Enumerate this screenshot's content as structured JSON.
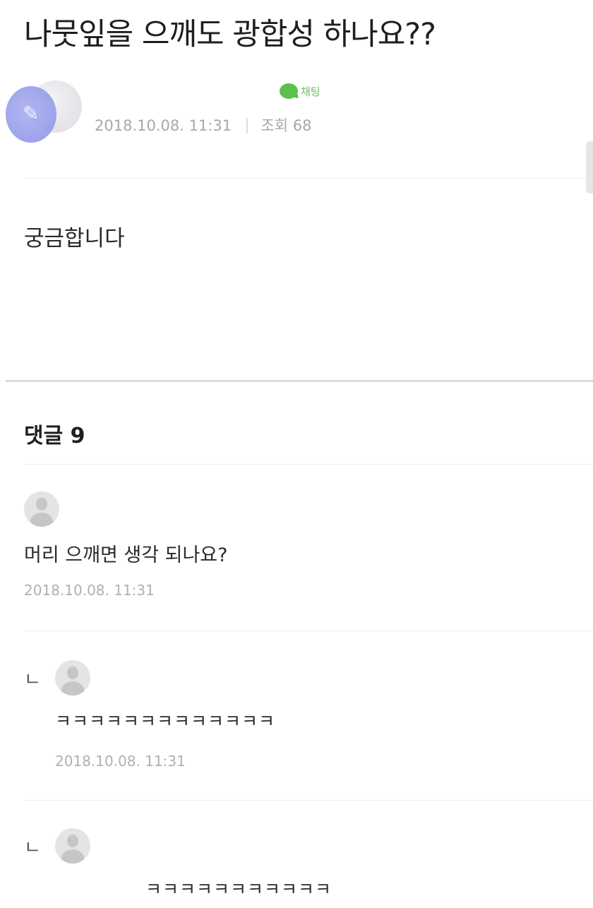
{
  "post": {
    "title": "나뭇잎을 으깨도 광합성 하나요??",
    "date": "2018.10.08. 11:31",
    "views_label": "조회 68",
    "chat_label": "채팅",
    "body": "궁금합니다"
  },
  "comments_header": "댓글 9",
  "comments": [
    {
      "text": "머리 으깨면 생각 되나요?",
      "date": "2018.10.08. 11:31"
    },
    {
      "reply_mark": "ㄴ",
      "text": "ㅋㅋㅋㅋㅋㅋㅋㅋㅋㅋㅋㅋㅋ",
      "date": "2018.10.08. 11:31"
    },
    {
      "reply_mark": "ㄴ",
      "text": "ㅋㅋㅋㅋㅋㅋㅋㅋㅋㅋㅋ"
    }
  ],
  "colors": {
    "chat_green": "#5cc04c",
    "meta_gray": "#a8a8a8"
  }
}
